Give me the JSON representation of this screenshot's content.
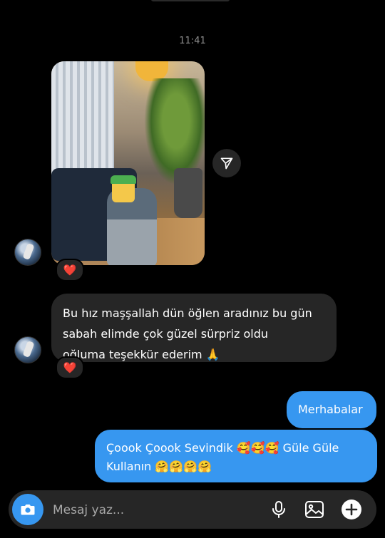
{
  "chat": {
    "timestamp": "11:41",
    "photo_message": {
      "reaction": "❤️"
    },
    "incoming_message": {
      "text_line1": "Bu hız maşşallah dün öğlen aradınız bu gün",
      "text_line2": "sabah elimde çok güzel sürpriz oldu",
      "text_line3": "oğluma teşekkür ederim 🙏",
      "reaction": "❤️"
    },
    "outgoing_messages": [
      {
        "text": "Merhabalar"
      },
      {
        "text_line1": "Çoook Çoook Sevindik 🥰🥰🥰 Güle Güle",
        "text_line2": "Kullanın 🤗🤗🤗🤗"
      }
    ]
  },
  "composer": {
    "placeholder": "Mesaj yaz...",
    "icons": [
      "camera-icon",
      "microphone-icon",
      "gallery-icon",
      "plus-icon"
    ],
    "accent_color": "#3797f0"
  },
  "colors": {
    "background": "#000000",
    "incoming_bubble": "#262626",
    "outgoing_bubble": "#3797f0"
  }
}
